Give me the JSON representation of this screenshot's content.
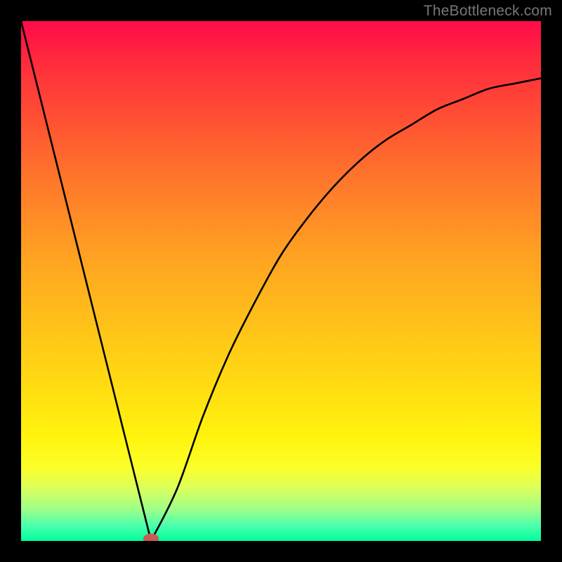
{
  "watermark": "TheBottleneck.com",
  "chart_data": {
    "type": "line",
    "title": "",
    "xlabel": "",
    "ylabel": "",
    "xlim": [
      0,
      1
    ],
    "ylim": [
      0,
      1
    ],
    "grid": false,
    "legend": false,
    "annotations": [],
    "series": [
      {
        "name": "bottleneck-curve",
        "x": [
          0.0,
          0.05,
          0.1,
          0.15,
          0.2,
          0.25,
          0.3,
          0.35,
          0.4,
          0.45,
          0.5,
          0.55,
          0.6,
          0.65,
          0.7,
          0.75,
          0.8,
          0.85,
          0.9,
          0.95,
          1.0
        ],
        "values": [
          1.0,
          0.8,
          0.6,
          0.4,
          0.2,
          0.0,
          0.1,
          0.24,
          0.36,
          0.46,
          0.55,
          0.62,
          0.68,
          0.73,
          0.77,
          0.8,
          0.83,
          0.85,
          0.87,
          0.88,
          0.89
        ]
      }
    ],
    "marker": {
      "name": "min-point",
      "x": 0.25,
      "y": 0.0,
      "rx": 0.015,
      "ry": 0.01,
      "color": "#cc5a57"
    },
    "background": {
      "type": "vertical-gradient",
      "stops": [
        {
          "pos": 0.0,
          "color": "#ff0a4a"
        },
        {
          "pos": 0.5,
          "color": "#ffb01f"
        },
        {
          "pos": 0.85,
          "color": "#fff40d"
        },
        {
          "pos": 1.0,
          "color": "#00ff9c"
        }
      ]
    }
  }
}
